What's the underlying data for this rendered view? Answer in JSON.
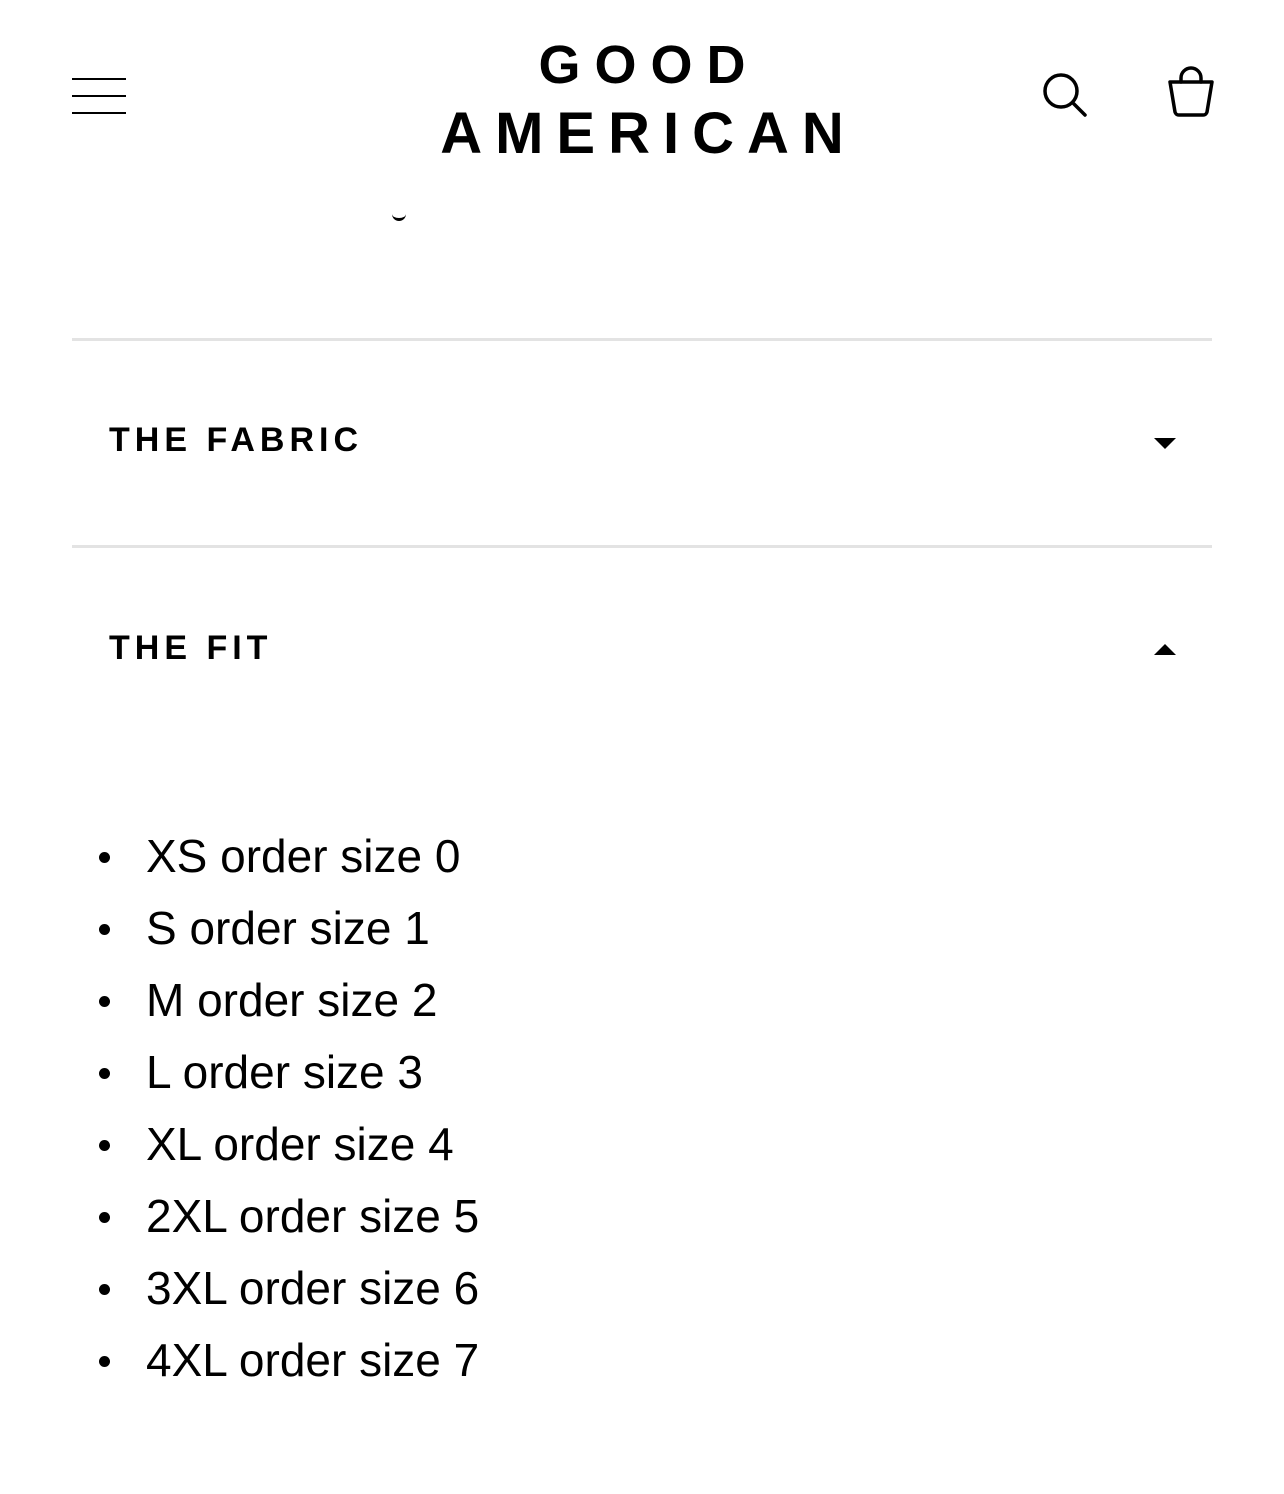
{
  "header": {
    "brand_line1": "GOOD",
    "brand_line2": "AMERICAN",
    "icons": {
      "menu": "hamburger-menu-icon",
      "search": "search-icon",
      "cart": "shopping-bag-icon"
    }
  },
  "accordion": {
    "sections": [
      {
        "title": "THE FABRIC",
        "expanded": false
      },
      {
        "title": "THE FIT",
        "expanded": true
      }
    ]
  },
  "fit_sizes": [
    "XS order size 0",
    "S order size 1",
    "M order size 2",
    "L order size 3",
    "XL order size 4",
    "2XL order size 5",
    "3XL order size 6",
    "4XL order size 7"
  ],
  "colors": {
    "text": "#000000",
    "divider": "#e3e3e3",
    "background": "#ffffff"
  }
}
